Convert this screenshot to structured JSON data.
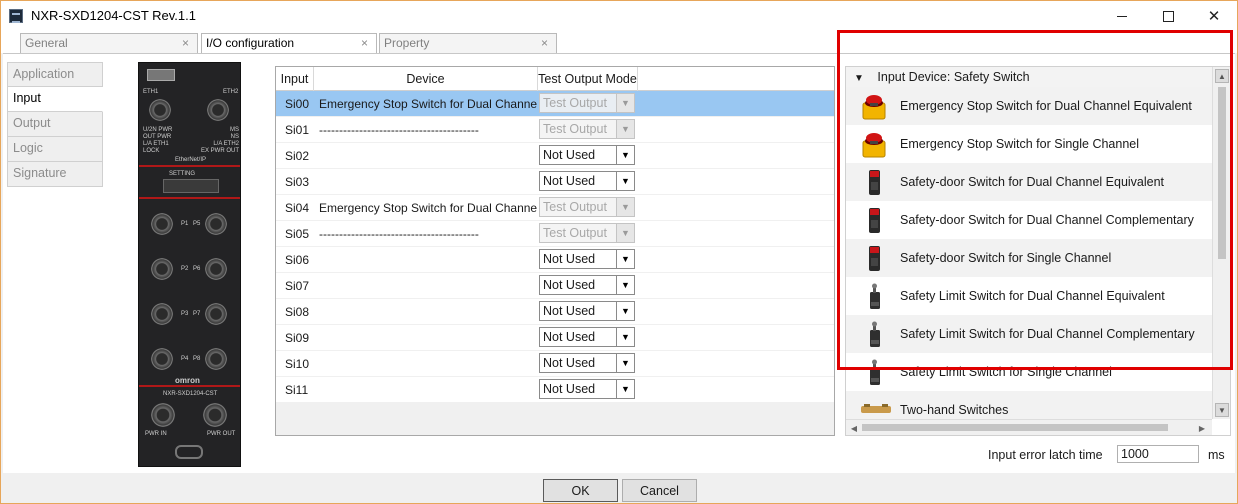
{
  "window": {
    "title": "NXR-SXD1204-CST Rev.1.1",
    "minimize_icon": "minimize-icon",
    "maximize_icon": "maximize-icon",
    "close_glyph": "✕"
  },
  "tabs": [
    {
      "label": "General",
      "active": false,
      "close": "×"
    },
    {
      "label": "I/O configuration",
      "active": true,
      "close": "×"
    },
    {
      "label": "Property",
      "active": false,
      "close": "×"
    }
  ],
  "leftnav": [
    {
      "label": "Application",
      "active": false
    },
    {
      "label": "Input",
      "active": true
    },
    {
      "label": "Output",
      "active": false
    },
    {
      "label": "Logic",
      "active": false
    },
    {
      "label": "Signature",
      "active": false
    }
  ],
  "device_image": {
    "labels": {
      "eth1": "ETH1",
      "eth2": "ETH2",
      "status_left": "U/2N PWR\nOUT PWR\nL/A ETH1\nLOCK",
      "status_right": "MS\nNS\nL/A ETH2\nEX PWR OUT",
      "ethernet": "EtherNet/IP",
      "setting": "SETTING",
      "brand": "omron",
      "model": "NXR-SXD1204-CST",
      "pwr_in": "PWR IN",
      "pwr_out": "PWR OUT",
      "p1": "P1",
      "p5": "P5",
      "p2": "P2",
      "p6": "P6",
      "p3": "P3",
      "p7": "P7",
      "p4": "P4",
      "p8": "P8"
    }
  },
  "io_table": {
    "headers": {
      "input": "Input",
      "device": "Device",
      "mode": "Test Output Mode"
    },
    "rows": [
      {
        "input": "Si00",
        "device": "Emergency Stop Switch for Dual Channe",
        "mode": "Test Output",
        "disabled": true,
        "selected": true
      },
      {
        "input": "Si01",
        "device": "----------------------------------------",
        "mode": "Test Output",
        "disabled": true,
        "selected": false
      },
      {
        "input": "Si02",
        "device": "",
        "mode": "Not Used",
        "disabled": false,
        "selected": false
      },
      {
        "input": "Si03",
        "device": "",
        "mode": "Not Used",
        "disabled": false,
        "selected": false
      },
      {
        "input": "Si04",
        "device": "Emergency Stop Switch for Dual Channe",
        "mode": "Test Output",
        "disabled": true,
        "selected": false
      },
      {
        "input": "Si05",
        "device": "----------------------------------------",
        "mode": "Test Output",
        "disabled": true,
        "selected": false
      },
      {
        "input": "Si06",
        "device": "",
        "mode": "Not Used",
        "disabled": false,
        "selected": false
      },
      {
        "input": "Si07",
        "device": "",
        "mode": "Not Used",
        "disabled": false,
        "selected": false
      },
      {
        "input": "Si08",
        "device": "",
        "mode": "Not Used",
        "disabled": false,
        "selected": false
      },
      {
        "input": "Si09",
        "device": "",
        "mode": "Not Used",
        "disabled": false,
        "selected": false
      },
      {
        "input": "Si10",
        "device": "",
        "mode": "Not Used",
        "disabled": false,
        "selected": false
      },
      {
        "input": "Si11",
        "device": "",
        "mode": "Not Used",
        "disabled": false,
        "selected": false
      }
    ],
    "dropdown_glyph": "▼"
  },
  "input_device_panel": {
    "header": "Input Device: Safety Switch",
    "collapse_glyph": "▼",
    "items": [
      {
        "label": "Emergency Stop Switch for Dual Channel Equivalent",
        "icon": "emergency-stop-icon"
      },
      {
        "label": "Emergency Stop Switch for Single Channel",
        "icon": "emergency-stop-icon"
      },
      {
        "label": "Safety-door Switch for Dual Channel Equivalent",
        "icon": "safety-door-switch-icon"
      },
      {
        "label": "Safety-door Switch for Dual Channel Complementary",
        "icon": "safety-door-switch-icon"
      },
      {
        "label": "Safety-door Switch for Single Channel",
        "icon": "safety-door-switch-icon"
      },
      {
        "label": "Safety Limit Switch for Dual Channel Equivalent",
        "icon": "limit-switch-icon"
      },
      {
        "label": "Safety Limit Switch for Dual Channel Complementary",
        "icon": "limit-switch-icon"
      },
      {
        "label": "Safety Limit Switch for Single Channel",
        "icon": "limit-switch-icon"
      },
      {
        "label": "Two-hand Switches",
        "icon": "two-hand-switch-icon"
      }
    ],
    "scroll_up": "▲",
    "scroll_down": "▼",
    "scroll_left": "◀",
    "scroll_right": "▶",
    "highlight_color": "#e00000"
  },
  "latch": {
    "label": "Input error latch time",
    "value": "1000",
    "unit": "ms"
  },
  "buttons": {
    "ok": "OK",
    "cancel": "Cancel"
  },
  "colors": {
    "selection": "#99c7f2",
    "window_border": "#e7a65a"
  }
}
